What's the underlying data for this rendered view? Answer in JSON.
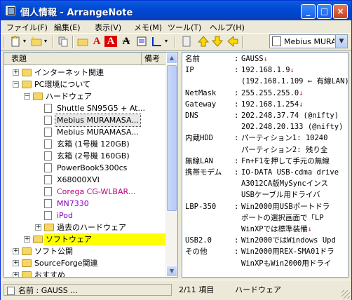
{
  "window": {
    "title": "個人情報 - ArrangeNote",
    "buttons": {
      "minimize": "_",
      "maximize": "□",
      "close": "×"
    }
  },
  "menu": [
    "ファイル(F)",
    "編集(E)",
    "表示(V)",
    "メモ(M)",
    "ツール(T)",
    "ヘルプ(H)"
  ],
  "toolbar": {
    "icons": [
      "new-note-icon",
      "new-folder-icon",
      "copy-icon",
      "open-folder-icon",
      "font-red-icon",
      "font-red-bg-icon",
      "strikethrough-icon",
      "document-icon",
      "chart-icon",
      "page-icon",
      "up-arrow-icon",
      "down-arrow-icon",
      "back-arrow-icon"
    ],
    "font_red": "A",
    "font_red_bg": "A",
    "strike": "A",
    "combo_value": "Mebius MURA..."
  },
  "tree": {
    "headers": {
      "title": "表題",
      "notes": "備考"
    },
    "items": [
      {
        "label": "インターネット関連",
        "level": 0,
        "expander": "+",
        "icon": "folder-icon"
      },
      {
        "label": "PC環境について",
        "level": 0,
        "expander": "−",
        "icon": "folder-icon"
      },
      {
        "label": "ハードウェア",
        "level": 1,
        "expander": "−",
        "icon": "folder-open-icon"
      },
      {
        "label": "Shuttle SN95G5 + At...",
        "level": 2,
        "expander": "",
        "icon": "document-icon"
      },
      {
        "label": "Mebius MURAMASA...",
        "level": 2,
        "expander": "",
        "icon": "document-icon",
        "selected": true
      },
      {
        "label": "Mebius MURAMASA...",
        "level": 2,
        "expander": "",
        "icon": "document-icon"
      },
      {
        "label": "玄箱 (1号機 120GB)",
        "level": 2,
        "expander": "",
        "icon": "document-icon"
      },
      {
        "label": "玄箱 (2号機 160GB)",
        "level": 2,
        "expander": "",
        "icon": "document-icon"
      },
      {
        "label": "PowerBook5300cs",
        "level": 2,
        "expander": "",
        "icon": "document-icon"
      },
      {
        "label": "X68000XVI",
        "level": 2,
        "expander": "",
        "icon": "document-icon"
      },
      {
        "label": "Corega CG-WLBAR...",
        "level": 2,
        "expander": "",
        "icon": "document-icon",
        "color": "#c00080"
      },
      {
        "label": "MN7330",
        "level": 2,
        "expander": "",
        "icon": "document-icon",
        "color": "#8000c0"
      },
      {
        "label": "iPod",
        "level": 2,
        "expander": "",
        "icon": "document-icon",
        "color": "#8000c0"
      },
      {
        "label": "過去のハードウェア",
        "level": 2,
        "expander": "+",
        "icon": "folder-icon"
      },
      {
        "label": "ソフトウェア",
        "level": 1,
        "expander": "+",
        "icon": "folder-icon",
        "highlight": "#ffff00"
      },
      {
        "label": "ソフト公開",
        "level": 0,
        "expander": "+",
        "icon": "folder-icon"
      },
      {
        "label": "SourceForge関連",
        "level": 0,
        "expander": "+",
        "icon": "folder-icon"
      },
      {
        "label": "おすすめ",
        "level": 0,
        "expander": "+",
        "icon": "folder-icon"
      }
    ]
  },
  "detail": {
    "rows": [
      {
        "key": "名前",
        "value": "GAUSS",
        "ret": "↓"
      },
      {
        "key": "IP",
        "value": "192.168.1.9",
        "ret": "↓"
      },
      {
        "key": "",
        "value": "(192.168.1.109 ← 有線LAN)",
        "ret": ""
      },
      {
        "key": "NetMask",
        "value": "255.255.255.0",
        "ret": "↓"
      },
      {
        "key": "Gateway",
        "value": "192.168.1.254",
        "ret": "↓"
      },
      {
        "key": "DNS",
        "value": "202.248.37.74 (@nifty)",
        "ret": ""
      },
      {
        "key": "",
        "value": "202.248.20.133 (@nifty)",
        "ret": ""
      },
      {
        "key": "内蔵HDD",
        "value": "パーティション1: 10240",
        "ret": ""
      },
      {
        "key": "",
        "value": "パーティション2: 残り全",
        "ret": ""
      },
      {
        "key": "無線LAN",
        "value": "Fn+F1を押して手元の無線",
        "ret": ""
      },
      {
        "key": "携帯モデム",
        "value": "IO-DATA USB-cdma drive",
        "ret": ""
      },
      {
        "key": "",
        "value": "A3012CA版MySyncインス",
        "ret": ""
      },
      {
        "key": "",
        "value": "USBケーブル用ドライバ",
        "ret": ""
      },
      {
        "key": "LBP-350",
        "value": "Win2000用USBポートドラ",
        "ret": ""
      },
      {
        "key": "",
        "value": "ポートの選択画面で「LP",
        "ret": ""
      },
      {
        "key": "",
        "value": "WinXPでは標準装備",
        "ret": "↓"
      },
      {
        "key": "USB2.0",
        "value": "Win2000ではWindows Upd",
        "ret": ""
      },
      {
        "key": "その他",
        "value": "Win2000用REX-SMA01ドラ",
        "ret": ""
      },
      {
        "key": "",
        "value": "WinXPもWin2000用ドライ",
        "ret": ""
      }
    ]
  },
  "status": {
    "name": "名前 : GAUSS ...",
    "count": "2/11 項目",
    "folder": "ハードウェア"
  }
}
